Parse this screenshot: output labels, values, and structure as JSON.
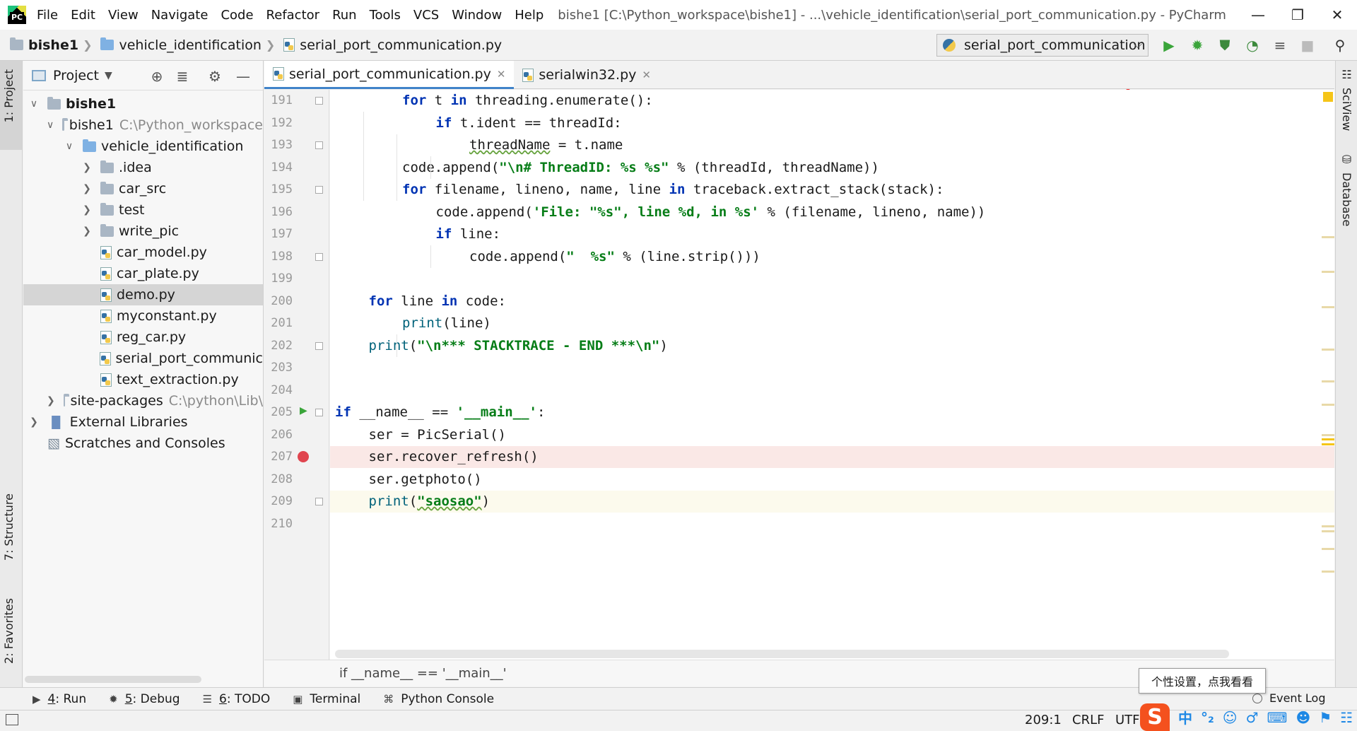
{
  "app": {
    "logo_text": "PC",
    "window_title": "bishe1 [C:\\Python_workspace\\bishe1] - ...\\vehicle_identification\\serial_port_communication.py - PyCharm"
  },
  "menu": [
    "File",
    "Edit",
    "View",
    "Navigate",
    "Code",
    "Refactor",
    "Run",
    "Tools",
    "VCS",
    "Window",
    "Help"
  ],
  "window_controls": [
    "minimize-icon",
    "restore-icon",
    "close-icon"
  ],
  "navbar": {
    "crumbs": [
      "bishe1",
      "vehicle_identification",
      "serial_port_communication.py"
    ],
    "run_config": "serial_port_communication",
    "toolbar_icons": [
      "run-icon",
      "debug-icon",
      "coverage-icon",
      "profile-icon",
      "build-icon",
      "stop-icon",
      "search-icon"
    ]
  },
  "left_strip": {
    "tabs": [
      "1: Project",
      "7: Structure",
      "2: Favorites"
    ]
  },
  "project": {
    "header": "Project",
    "tree": [
      {
        "label": "bishe1",
        "depth": 0,
        "type": "module",
        "expanded": true,
        "bold": true
      },
      {
        "label": "bishe1",
        "extra": "C:\\Python_workspace",
        "depth": 1,
        "type": "folder",
        "expanded": true
      },
      {
        "label": "vehicle_identification",
        "depth": 2,
        "type": "folder-blue",
        "expanded": true
      },
      {
        "label": ".idea",
        "depth": 3,
        "type": "folder",
        "expanded": false
      },
      {
        "label": "car_src",
        "depth": 3,
        "type": "folder",
        "expanded": false
      },
      {
        "label": "test",
        "depth": 3,
        "type": "folder",
        "expanded": false
      },
      {
        "label": "write_pic",
        "depth": 3,
        "type": "folder",
        "expanded": false
      },
      {
        "label": "car_model.py",
        "depth": 3,
        "type": "py"
      },
      {
        "label": "car_plate.py",
        "depth": 3,
        "type": "py"
      },
      {
        "label": "demo.py",
        "depth": 3,
        "type": "py",
        "selected": true
      },
      {
        "label": "myconstant.py",
        "depth": 3,
        "type": "py"
      },
      {
        "label": "reg_car.py",
        "depth": 3,
        "type": "py"
      },
      {
        "label": "serial_port_communic",
        "depth": 3,
        "type": "py"
      },
      {
        "label": "text_extraction.py",
        "depth": 3,
        "type": "py"
      },
      {
        "label": "site-packages",
        "extra": "C:\\python\\Lib\\",
        "depth": 1,
        "type": "folder",
        "expanded": false
      },
      {
        "label": "External Libraries",
        "depth": 0,
        "type": "libs",
        "expanded": false
      },
      {
        "label": "Scratches and Consoles",
        "depth": 0,
        "type": "scratch"
      }
    ]
  },
  "editor": {
    "tabs": [
      {
        "label": "serial_port_communication.py",
        "active": true
      },
      {
        "label": "serialwin32.py",
        "active": false
      }
    ],
    "lines": [
      {
        "n": "191",
        "tokens": [
          [
            "k",
            "for"
          ],
          [
            "p",
            " t "
          ],
          [
            "k",
            "in"
          ],
          [
            "p",
            " threading.enumerate():"
          ]
        ],
        "indent": 2
      },
      {
        "n": "192",
        "tokens": [
          [
            "k",
            "if"
          ],
          [
            "p",
            " t.ident == threadId:"
          ]
        ],
        "indent": 3
      },
      {
        "n": "193",
        "tokens": [
          [
            "u",
            "threadName"
          ],
          [
            "p",
            " = t.name"
          ]
        ],
        "indent": 4
      },
      {
        "n": "194",
        "tokens": [
          [
            "p",
            "code.append("
          ],
          [
            "s",
            "\"\\n# ThreadID: %s %s\""
          ],
          [
            "p",
            " % (threadId, threadName))"
          ]
        ],
        "indent": 2
      },
      {
        "n": "195",
        "tokens": [
          [
            "k",
            "for"
          ],
          [
            "p",
            " filename, lineno, name, line "
          ],
          [
            "k",
            "in"
          ],
          [
            "p",
            " traceback.extract_stack(stack):"
          ]
        ],
        "indent": 2
      },
      {
        "n": "196",
        "tokens": [
          [
            "p",
            "code.append("
          ],
          [
            "s",
            "'File: \"%s\", line %d, in %s'"
          ],
          [
            "p",
            " % (filename, lineno, name))"
          ]
        ],
        "indent": 3
      },
      {
        "n": "197",
        "tokens": [
          [
            "k",
            "if"
          ],
          [
            "p",
            " line:"
          ]
        ],
        "indent": 3
      },
      {
        "n": "198",
        "tokens": [
          [
            "p",
            "code.append("
          ],
          [
            "s",
            "\"  %s\""
          ],
          [
            "p",
            " % (line.strip()))"
          ]
        ],
        "indent": 4
      },
      {
        "n": "199",
        "tokens": [],
        "indent": 0
      },
      {
        "n": "200",
        "tokens": [
          [
            "k",
            "for"
          ],
          [
            "p",
            " line "
          ],
          [
            "k",
            "in"
          ],
          [
            "p",
            " code:"
          ]
        ],
        "indent": 1
      },
      {
        "n": "201",
        "tokens": [
          [
            "f",
            "print"
          ],
          [
            "p",
            "(line)"
          ]
        ],
        "indent": 2
      },
      {
        "n": "202",
        "tokens": [
          [
            "f",
            "print"
          ],
          [
            "p",
            "("
          ],
          [
            "s",
            "\"\\n*** STACKTRACE - END ***\\n\""
          ],
          [
            "p",
            ")"
          ]
        ],
        "indent": 1
      },
      {
        "n": "203",
        "tokens": [],
        "indent": 0
      },
      {
        "n": "204",
        "tokens": [],
        "indent": 0
      },
      {
        "n": "205",
        "tokens": [
          [
            "k",
            "if"
          ],
          [
            "p",
            " __name__ == "
          ],
          [
            "s",
            "'__main__'"
          ],
          [
            "p",
            ":"
          ]
        ],
        "indent": 0
      },
      {
        "n": "206",
        "tokens": [
          [
            "p",
            "ser = PicSerial()"
          ]
        ],
        "indent": 1
      },
      {
        "n": "207",
        "tokens": [
          [
            "p",
            "ser.recover_refresh()"
          ]
        ],
        "indent": 1
      },
      {
        "n": "208",
        "tokens": [
          [
            "p",
            "ser.getphoto()"
          ]
        ],
        "indent": 1
      },
      {
        "n": "209",
        "tokens": [
          [
            "f",
            "print"
          ],
          [
            "p",
            "("
          ],
          [
            "su",
            "\"saosao\""
          ],
          [
            "p",
            ")"
          ]
        ],
        "indent": 1
      },
      {
        "n": "210",
        "tokens": [],
        "indent": 0
      }
    ],
    "breakpoint_line": "207",
    "current_line": "209",
    "run_gutter_line": "205",
    "breadcrumb": "if __name__ == '__main__'"
  },
  "right_strip": {
    "tabs": [
      "SciView",
      "Database"
    ]
  },
  "bottom_tools": [
    {
      "num": "4",
      "label": ": Run",
      "icon": "run-icon"
    },
    {
      "num": "5",
      "label": ": Debug",
      "icon": "debug-icon"
    },
    {
      "num": "6",
      "label": ": TODO",
      "icon": "todo-icon"
    },
    {
      "num": "",
      "label": "Terminal",
      "icon": "terminal-icon"
    },
    {
      "num": "",
      "label": "Python Console",
      "icon": "python-console-icon"
    }
  ],
  "event_log": "Event Log",
  "status": {
    "position": "209:1",
    "line_sep": "CRLF",
    "encoding": "UTF-"
  },
  "tooltip": "个性设置，点我看看",
  "ime": {
    "logo": "S",
    "lang": "中"
  },
  "colors": {
    "keyword": "#0033b3",
    "string": "#067d17",
    "breakpoint": "#e0454f",
    "accent": "#4083c9",
    "annotation_arrow": "#ef2b2b"
  }
}
